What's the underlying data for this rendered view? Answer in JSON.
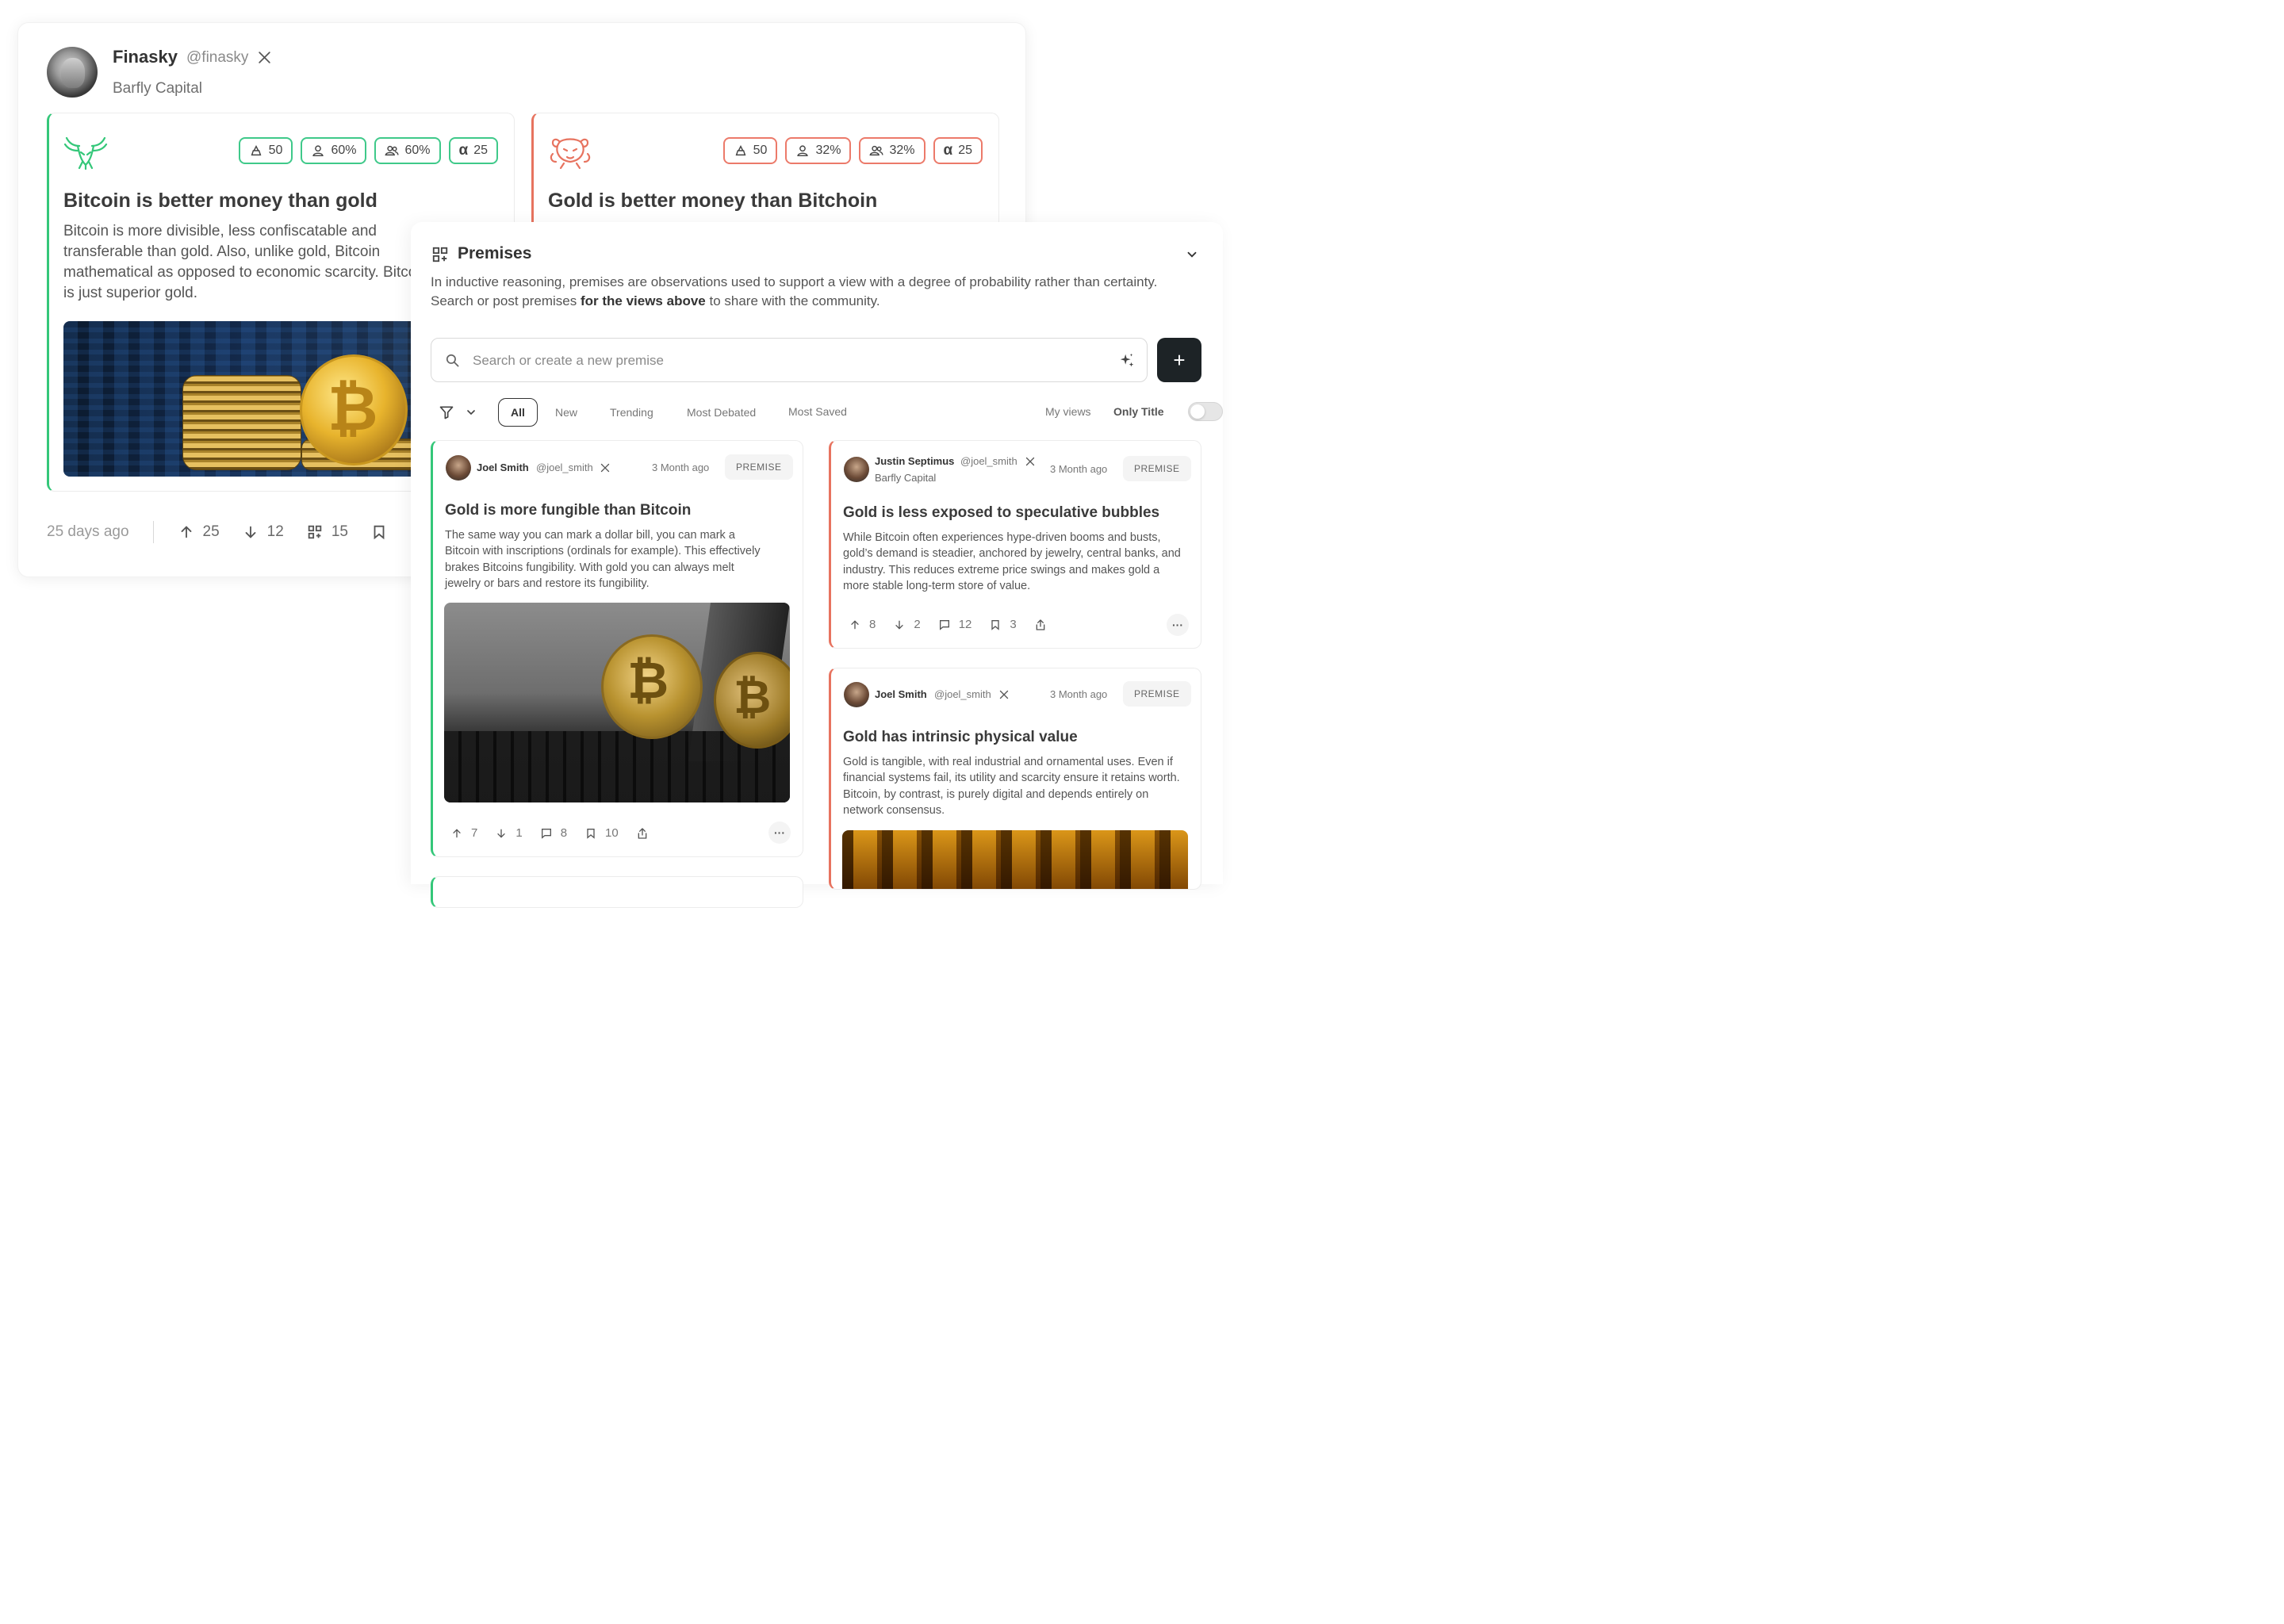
{
  "profile": {
    "name": "Finasky",
    "handle": "@finasky",
    "org": "Barfly Capital"
  },
  "views": [
    {
      "side": "pro",
      "accent": "#34c779",
      "badges": [
        "50",
        "60%",
        "60%",
        "25"
      ],
      "title": "Bitcoin is better money than gold",
      "description": "Bitcoin is more divisible, less confiscatable and transferable than gold. Also, unlike gold, Bitcoin mathematical as opposed to economic scarcity. Bitcoin is just superior gold."
    },
    {
      "side": "con",
      "accent": "#e7735f",
      "badges": [
        "50",
        "32%",
        "32%",
        "25"
      ],
      "title": "Gold is better money than Bitchoin"
    }
  ],
  "view_footer": {
    "time": "25 days ago",
    "upvotes": "25",
    "downvotes": "12",
    "premises": "15"
  },
  "premises_panel": {
    "title": "Premises",
    "desc_part1": "In inductive reasoning, premises are observations used to support a view with a degree of probability rather than certainty.  Search or post premises ",
    "desc_bold": "for the views above",
    "desc_part2": " to share with the community.",
    "search_placeholder": "Search or create a new premise",
    "add_label": "+",
    "tabs": [
      "All",
      "New",
      "Trending",
      "Most Debated",
      "Most Saved"
    ],
    "my_views": "My views",
    "only_title": "Only Title"
  },
  "premises": [
    {
      "author": "Joel Smith",
      "handle": "@joel_smith",
      "time": "3 Month ago",
      "tag": "PREMISE",
      "title": "Gold is more fungible than Bitcoin",
      "body": "The same way you can mark a dollar bill, you can mark a Bitcoin with inscriptions (ordinals for example).  This effectively brakes Bitcoins fungibility. With gold you can always melt jewelry or bars and restore its fungibility.",
      "up": "7",
      "down": "1",
      "comments": "8",
      "saves": "10"
    },
    {
      "author": "Justin Septimus",
      "handle": "@joel_smith",
      "org": "Barfly Capital",
      "time": "3 Month ago",
      "tag": "PREMISE",
      "title": "Gold is less exposed to speculative bubbles",
      "body": "While Bitcoin often experiences hype-driven booms and busts, gold’s demand is steadier, anchored by jewelry, central banks, and industry. This reduces extreme price swings and makes gold a more stable long-term store of value.",
      "up": "8",
      "down": "2",
      "comments": "12",
      "saves": "3"
    },
    {
      "author": "Joel Smith",
      "handle": "@joel_smith",
      "time": "3 Month ago",
      "tag": "PREMISE",
      "title": "Gold has intrinsic physical value",
      "body": "Gold is tangible, with real industrial and ornamental uses. Even if financial systems fail, its utility and scarcity ensure it retains worth. Bitcoin, by contrast, is purely digital and depends entirely on network consensus."
    }
  ]
}
